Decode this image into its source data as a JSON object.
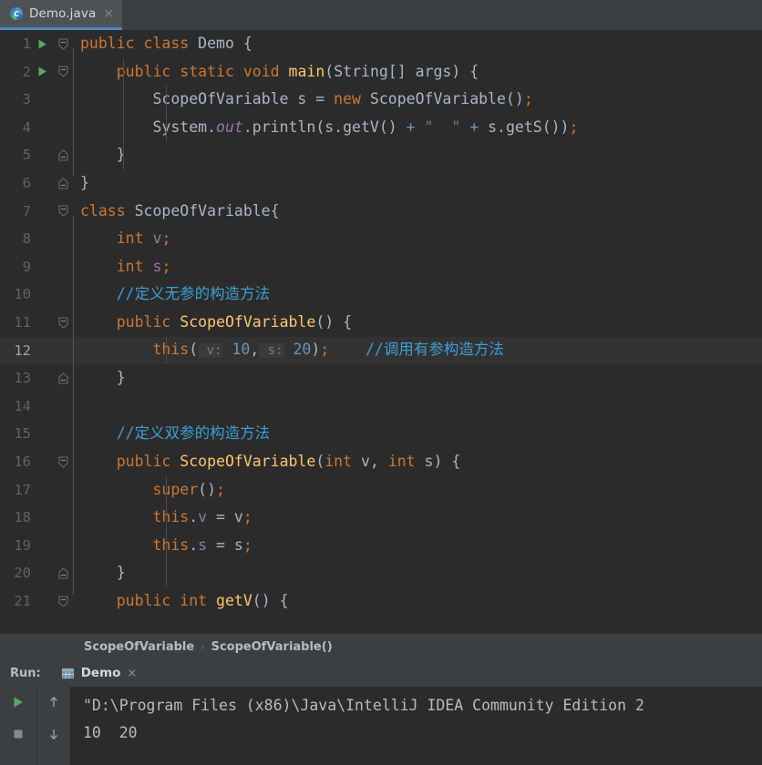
{
  "editor_tab": {
    "label": "Demo.java",
    "icon": "java-class-icon",
    "close_icon": "close-icon",
    "close_label": "×"
  },
  "editor": {
    "lines": [
      {
        "number": "1",
        "run_marker": true,
        "fold": "open",
        "current": false,
        "tokens": [
          {
            "t": "public",
            "c": "kw"
          },
          {
            "t": " ",
            "c": "pln"
          },
          {
            "t": "class",
            "c": "kw"
          },
          {
            "t": " ",
            "c": "pln"
          },
          {
            "t": "Demo",
            "c": "cls"
          },
          {
            "t": " {",
            "c": "pln"
          }
        ]
      },
      {
        "number": "2",
        "run_marker": true,
        "fold": "open",
        "current": false,
        "tokens": [
          {
            "t": "    ",
            "c": "pln"
          },
          {
            "t": "public",
            "c": "kw"
          },
          {
            "t": " ",
            "c": "pln"
          },
          {
            "t": "static",
            "c": "kw"
          },
          {
            "t": " ",
            "c": "pln"
          },
          {
            "t": "void",
            "c": "kw"
          },
          {
            "t": " ",
            "c": "pln"
          },
          {
            "t": "main",
            "c": "mth"
          },
          {
            "t": "(",
            "c": "pln"
          },
          {
            "t": "String",
            "c": "cls"
          },
          {
            "t": "[] args) {",
            "c": "pln"
          }
        ]
      },
      {
        "number": "3",
        "run_marker": false,
        "fold": "none",
        "current": false,
        "tokens": [
          {
            "t": "        ",
            "c": "pln"
          },
          {
            "t": "ScopeOfVariable",
            "c": "cls"
          },
          {
            "t": " s = ",
            "c": "pln"
          },
          {
            "t": "new",
            "c": "kw"
          },
          {
            "t": " ",
            "c": "pln"
          },
          {
            "t": "ScopeOfVariable",
            "c": "cls"
          },
          {
            "t": "()",
            "c": "pln"
          },
          {
            "t": ";",
            "c": "semi"
          }
        ]
      },
      {
        "number": "4",
        "run_marker": false,
        "fold": "none",
        "current": false,
        "tokens": [
          {
            "t": "        ",
            "c": "pln"
          },
          {
            "t": "System",
            "c": "cls"
          },
          {
            "t": ".",
            "c": "pln"
          },
          {
            "t": "out",
            "c": "fldi"
          },
          {
            "t": ".println(s.getV() ",
            "c": "pln"
          },
          {
            "t": "+",
            "c": "num"
          },
          {
            "t": " ",
            "c": "pln"
          },
          {
            "t": "\"  \"",
            "c": "str"
          },
          {
            "t": " ",
            "c": "pln"
          },
          {
            "t": "+",
            "c": "num"
          },
          {
            "t": " s.getS())",
            "c": "pln"
          },
          {
            "t": ";",
            "c": "semi"
          }
        ]
      },
      {
        "number": "5",
        "run_marker": false,
        "fold": "close",
        "current": false,
        "tokens": [
          {
            "t": "    }",
            "c": "pln"
          }
        ]
      },
      {
        "number": "6",
        "run_marker": false,
        "fold": "close",
        "current": false,
        "tokens": [
          {
            "t": "}",
            "c": "pln"
          }
        ]
      },
      {
        "number": "7",
        "run_marker": false,
        "fold": "open",
        "current": false,
        "tokens": [
          {
            "t": "class",
            "c": "kw"
          },
          {
            "t": " ",
            "c": "pln"
          },
          {
            "t": "ScopeOfVariable",
            "c": "cls"
          },
          {
            "t": "{",
            "c": "pln"
          }
        ]
      },
      {
        "number": "8",
        "run_marker": false,
        "fold": "none",
        "current": false,
        "tokens": [
          {
            "t": "    ",
            "c": "pln"
          },
          {
            "t": "int",
            "c": "kw"
          },
          {
            "t": " ",
            "c": "pln"
          },
          {
            "t": "v",
            "c": "fld"
          },
          {
            "t": ";",
            "c": "semi"
          }
        ]
      },
      {
        "number": "9",
        "run_marker": false,
        "fold": "none",
        "current": false,
        "tokens": [
          {
            "t": "    ",
            "c": "pln"
          },
          {
            "t": "int",
            "c": "kw"
          },
          {
            "t": " ",
            "c": "pln"
          },
          {
            "t": "s",
            "c": "fld"
          },
          {
            "t": ";",
            "c": "semi"
          }
        ]
      },
      {
        "number": "10",
        "run_marker": false,
        "fold": "none",
        "current": false,
        "tokens": [
          {
            "t": "    ",
            "c": "pln"
          },
          {
            "t": "//定义无参的构造方法",
            "c": "cmt"
          }
        ]
      },
      {
        "number": "11",
        "run_marker": false,
        "fold": "open",
        "current": false,
        "tokens": [
          {
            "t": "    ",
            "c": "pln"
          },
          {
            "t": "public",
            "c": "kw"
          },
          {
            "t": " ",
            "c": "pln"
          },
          {
            "t": "ScopeOfVariable",
            "c": "mth"
          },
          {
            "t": "() {",
            "c": "pln"
          }
        ]
      },
      {
        "number": "12",
        "run_marker": false,
        "fold": "none",
        "current": true,
        "tokens": [
          {
            "t": "        ",
            "c": "pln"
          },
          {
            "t": "this",
            "c": "kw"
          },
          {
            "t": "(",
            "c": "pln"
          },
          {
            "t": " v:",
            "c": "hint"
          },
          {
            "t": " ",
            "c": "pln"
          },
          {
            "t": "10",
            "c": "num"
          },
          {
            "t": ",",
            "c": "pln"
          },
          {
            "t": " s:",
            "c": "hint"
          },
          {
            "t": " ",
            "c": "pln"
          },
          {
            "t": "20",
            "c": "num"
          },
          {
            "t": ")",
            "c": "pln"
          },
          {
            "t": ";",
            "c": "semi"
          },
          {
            "t": "    ",
            "c": "pln"
          },
          {
            "t": "//调用有参构造方法",
            "c": "cmt"
          }
        ]
      },
      {
        "number": "13",
        "run_marker": false,
        "fold": "close",
        "current": false,
        "tokens": [
          {
            "t": "    }",
            "c": "pln"
          }
        ]
      },
      {
        "number": "14",
        "run_marker": false,
        "fold": "none",
        "current": false,
        "tokens": [
          {
            "t": "",
            "c": "pln"
          }
        ]
      },
      {
        "number": "15",
        "run_marker": false,
        "fold": "none",
        "current": false,
        "tokens": [
          {
            "t": "    ",
            "c": "pln"
          },
          {
            "t": "//定义双参的构造方法",
            "c": "cmt"
          }
        ]
      },
      {
        "number": "16",
        "run_marker": false,
        "fold": "open",
        "current": false,
        "tokens": [
          {
            "t": "    ",
            "c": "pln"
          },
          {
            "t": "public",
            "c": "kw"
          },
          {
            "t": " ",
            "c": "pln"
          },
          {
            "t": "ScopeOfVariable",
            "c": "mth"
          },
          {
            "t": "(",
            "c": "pln"
          },
          {
            "t": "int",
            "c": "kw"
          },
          {
            "t": " v, ",
            "c": "pln"
          },
          {
            "t": "int",
            "c": "kw"
          },
          {
            "t": " s) {",
            "c": "pln"
          }
        ]
      },
      {
        "number": "17",
        "run_marker": false,
        "fold": "none",
        "current": false,
        "tokens": [
          {
            "t": "        ",
            "c": "pln"
          },
          {
            "t": "super",
            "c": "kw"
          },
          {
            "t": "()",
            "c": "pln"
          },
          {
            "t": ";",
            "c": "semi"
          }
        ]
      },
      {
        "number": "18",
        "run_marker": false,
        "fold": "none",
        "current": false,
        "tokens": [
          {
            "t": "        ",
            "c": "pln"
          },
          {
            "t": "this",
            "c": "kw"
          },
          {
            "t": ".",
            "c": "pln"
          },
          {
            "t": "v",
            "c": "fld"
          },
          {
            "t": " = v",
            "c": "pln"
          },
          {
            "t": ";",
            "c": "semi"
          }
        ]
      },
      {
        "number": "19",
        "run_marker": false,
        "fold": "none",
        "current": false,
        "tokens": [
          {
            "t": "        ",
            "c": "pln"
          },
          {
            "t": "this",
            "c": "kw"
          },
          {
            "t": ".",
            "c": "pln"
          },
          {
            "t": "s",
            "c": "fld"
          },
          {
            "t": " = s",
            "c": "pln"
          },
          {
            "t": ";",
            "c": "semi"
          }
        ]
      },
      {
        "number": "20",
        "run_marker": false,
        "fold": "close",
        "current": false,
        "tokens": [
          {
            "t": "    }",
            "c": "pln"
          }
        ]
      },
      {
        "number": "21",
        "run_marker": false,
        "fold": "open",
        "current": false,
        "tokens": [
          {
            "t": "    ",
            "c": "pln"
          },
          {
            "t": "public",
            "c": "kw"
          },
          {
            "t": " ",
            "c": "pln"
          },
          {
            "t": "int",
            "c": "kw"
          },
          {
            "t": " ",
            "c": "pln"
          },
          {
            "t": "getV",
            "c": "mth"
          },
          {
            "t": "() {",
            "c": "pln"
          }
        ]
      }
    ]
  },
  "breadcrumbs": {
    "separator": "›",
    "items": [
      "ScopeOfVariable",
      "ScopeOfVariable()"
    ]
  },
  "run_window": {
    "title": "Run:",
    "tab": {
      "label": "Demo",
      "icon": "console-icon",
      "close_label": "×"
    },
    "toolbar_left": [
      {
        "name": "rerun-button",
        "icon": "play-icon"
      },
      {
        "name": "stop-button",
        "icon": "stop-icon"
      }
    ],
    "toolbar_right": [
      {
        "name": "scroll-up-button",
        "icon": "arrow-up-icon"
      },
      {
        "name": "scroll-down-button",
        "icon": "arrow-down-icon"
      }
    ],
    "console_lines": [
      "\"D:\\Program Files (x86)\\Java\\IntelliJ IDEA Community Edition 2",
      "10  20"
    ]
  },
  "colors": {
    "editor_background": "#2b2b2b",
    "panel_background": "#3c3f41",
    "tab_selected_background": "#4e5254",
    "tab_underline": "#4a88c7",
    "keyword": "#cc7832",
    "method": "#ffc66d",
    "field": "#9876aa",
    "number": "#6897bb",
    "string": "#6a8759",
    "comment": "#3d9fd6",
    "text": "#a9b7c6",
    "line_number": "#606366",
    "current_line": "#323232",
    "run_green": "#59a869"
  }
}
